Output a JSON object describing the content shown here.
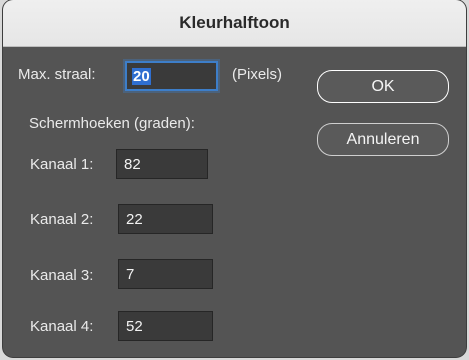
{
  "window": {
    "title": "Kleurhalftoon"
  },
  "max_radius": {
    "label": "Max. straal:",
    "value": "20",
    "unit": "(Pixels)"
  },
  "screen_angles": {
    "heading": "Schermhoeken (graden):",
    "channels": [
      {
        "label": "Kanaal 1:",
        "value": "82"
      },
      {
        "label": "Kanaal 2:",
        "value": "22"
      },
      {
        "label": "Kanaal 3:",
        "value": "7"
      },
      {
        "label": "Kanaal 4:",
        "value": "52"
      }
    ]
  },
  "buttons": {
    "ok": "OK",
    "cancel": "Annuleren"
  }
}
